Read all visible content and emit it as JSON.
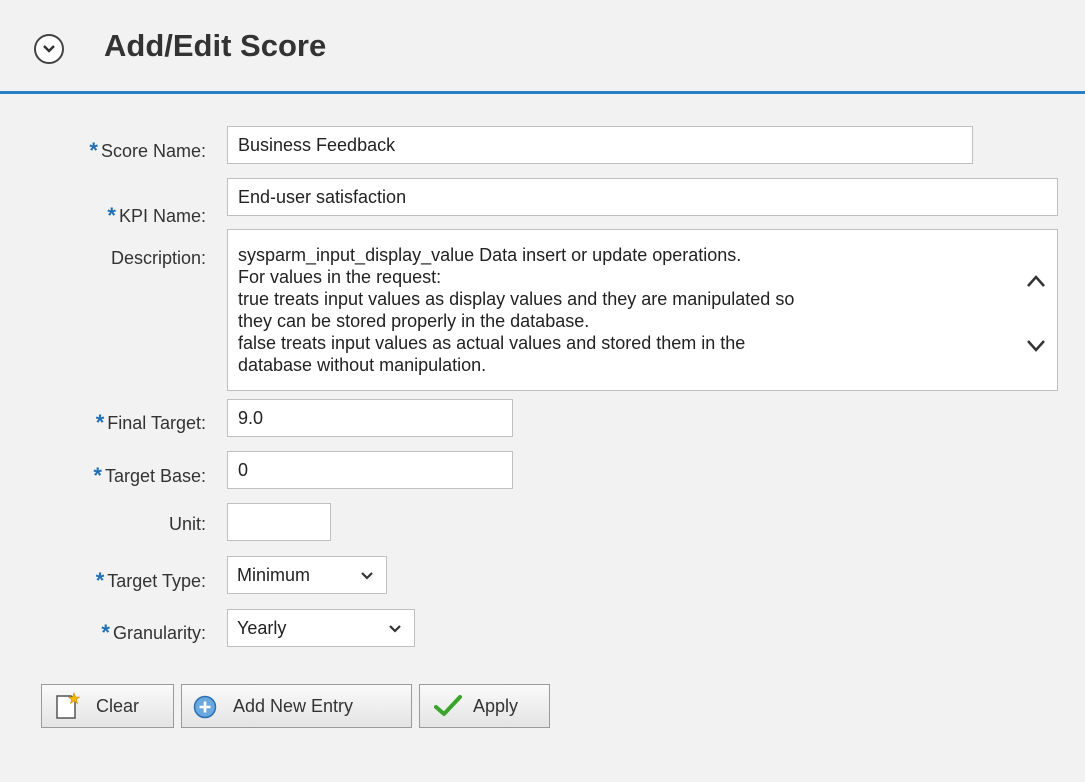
{
  "header": {
    "title": "Add/Edit Score"
  },
  "form": {
    "score_name": {
      "label": "Score Name:",
      "value": "Business Feedback"
    },
    "kpi_name": {
      "label": "KPI Name:",
      "value": "End-user satisfaction"
    },
    "description": {
      "label": "Description:",
      "value": "sysparm_input_display_value Data insert or update operations.\nFor values in the request:\ntrue treats input values as display values and they are manipulated so\nthey can be stored properly in the database.\nfalse treats input values as actual values and stored them in the\ndatabase without manipulation."
    },
    "final_target": {
      "label": "Final Target:",
      "value": "9.0"
    },
    "target_base": {
      "label": "Target Base:",
      "value": "0"
    },
    "unit": {
      "label": "Unit:",
      "value": ""
    },
    "target_type": {
      "label": "Target Type:",
      "value": "Minimum"
    },
    "granularity": {
      "label": "Granularity:",
      "value": "Yearly"
    },
    "required_marker": "*"
  },
  "buttons": {
    "clear": "Clear",
    "add_new_entry": "Add New Entry",
    "apply": "Apply"
  },
  "colors": {
    "accent": "#2a7ec2",
    "required": "#1f6fb5",
    "apply_check": "#3aa52b"
  }
}
